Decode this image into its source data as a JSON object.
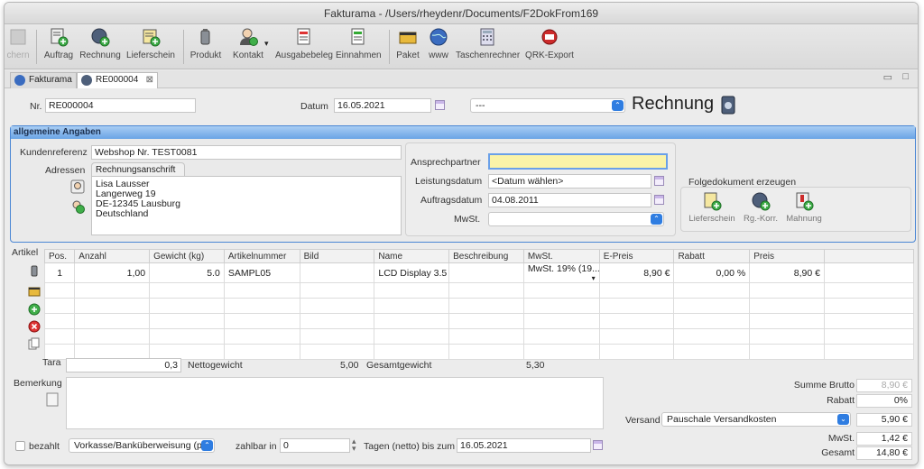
{
  "window": {
    "title": "Fakturama - /Users/rheydenr/Documents/F2DokFrom169"
  },
  "toolbar": {
    "items": [
      {
        "label": "chern"
      },
      {
        "label": "Auftrag"
      },
      {
        "label": "Rechnung"
      },
      {
        "label": "Lieferschein"
      },
      {
        "label": "Produkt"
      },
      {
        "label": "Kontakt"
      },
      {
        "label": "Ausgabebeleg"
      },
      {
        "label": "Einnahmen"
      },
      {
        "label": "Paket"
      },
      {
        "label": "www"
      },
      {
        "label": "Taschenrechner"
      },
      {
        "label": "QRK-Export"
      }
    ],
    "kontakt_dropdown": "▾"
  },
  "tabs": [
    {
      "label": "Fakturama"
    },
    {
      "label": "RE000004",
      "close": "⊠"
    }
  ],
  "window_controls": {
    "minimize": "▭",
    "maximize": "□"
  },
  "header": {
    "nr_label": "Nr.",
    "nr_value": "RE000004",
    "datum_label": "Datum",
    "datum_value": "16.05.2021",
    "status_value": "---",
    "doc_title": "Rechnung"
  },
  "general": {
    "heading": "allgemeine Angaben",
    "kundenreferenz_label": "Kundenreferenz",
    "kundenreferenz_value": "Webshop Nr. TEST0081",
    "adressen_label": "Adressen",
    "address_tab": "Rechnungsanschrift",
    "address_lines": [
      "Lisa Lausser",
      "Langerweg 19",
      "DE-12345 Lausburg",
      "Deutschland"
    ],
    "ansprechpartner_label": "Ansprechpartner",
    "ansprechpartner_value": "",
    "leistungsdatum_label": "Leistungsdatum",
    "leistungsdatum_value": "<Datum wählen>",
    "auftragsdatum_label": "Auftragsdatum",
    "auftragsdatum_value": "04.08.2011",
    "mwst_label": "MwSt.",
    "mwst_value": "",
    "folge_heading": "Folgedokument erzeugen",
    "folge_buttons": [
      {
        "label": "Lieferschein"
      },
      {
        "label": "Rg.-Korr."
      },
      {
        "label": "Mahnung"
      }
    ]
  },
  "items": {
    "label": "Artikel",
    "columns": [
      "Pos.",
      "Anzahl",
      "Gewicht (kg)",
      "Artikelnummer",
      "Bild",
      "Name",
      "Beschreibung",
      "MwSt.",
      "E-Preis",
      "Rabatt",
      "Preis",
      ""
    ],
    "rows": [
      [
        "1",
        "1,00",
        "5.0",
        "SAMPL05",
        "",
        "LCD Display 3.5",
        "",
        "MwSt. 19% (19...",
        "8,90 €",
        "0,00 %",
        "8,90 €",
        ""
      ]
    ]
  },
  "weights": {
    "tara_label": "Tara",
    "tara_value": "0,3",
    "netto_label": "Nettogewicht",
    "netto_value": "5,00",
    "gesamt_label": "Gesamtgewicht",
    "gesamt_value": "5,30"
  },
  "remarks": {
    "label": "Bemerkung",
    "value": ""
  },
  "totals": {
    "summe_brutto_label": "Summe Brutto",
    "summe_brutto_value": "8,90 €",
    "rabatt_label": "Rabatt",
    "rabatt_value": "0%",
    "versand_label": "Versand",
    "versand_option": "Pauschale Versandkosten",
    "versand_value": "5,90 €",
    "mwst_label": "MwSt.",
    "mwst_value": "1,42 €",
    "gesamt_label": "Gesamt",
    "gesamt_value": "14,80 €"
  },
  "payment": {
    "bezahlt_label": "bezahlt",
    "method_value": "Vorkasse/Banküberweisung (pre",
    "zahlbar_label": "zahlbar in",
    "zahlbar_value": "0",
    "tagen_label": "Tagen (netto) bis zum",
    "due_date": "16.05.2021"
  },
  "colors": {
    "accent": "#2f7de1",
    "group_header": "#6aa4e6",
    "highlight_field": "#faf3a8"
  }
}
